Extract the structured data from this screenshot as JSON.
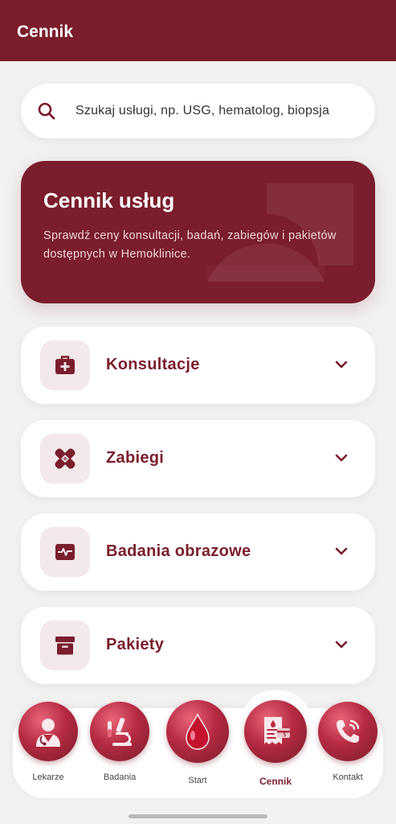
{
  "appbar": {
    "title": "Cennik"
  },
  "search": {
    "placeholder": "Szukaj usługi, np. USG, hematolog, biopsja",
    "icon": "search-icon"
  },
  "hero": {
    "title": "Cennik usług",
    "description": "Sprawdź ceny konsultacji, badań, zabiegów i pakietów dostępnych w Hemoklinice."
  },
  "categories": [
    {
      "label": "Konsultacje",
      "icon": "medical-kit-icon"
    },
    {
      "label": "Zabiegi",
      "icon": "bandage-icon"
    },
    {
      "label": "Badania obrazowe",
      "icon": "monitor-pulse-icon"
    },
    {
      "label": "Pakiety",
      "icon": "archive-box-icon"
    }
  ],
  "bottom_nav": {
    "items": [
      {
        "label": "Lekarze",
        "icon": "doctor-icon"
      },
      {
        "label": "Badania",
        "icon": "microscope-icon"
      },
      {
        "label": "Start",
        "icon": "blood-drop-icon"
      },
      {
        "label": "Cennik",
        "icon": "price-receipt-icon",
        "active": true
      },
      {
        "label": "Kontakt",
        "icon": "phone-icon"
      }
    ]
  },
  "colors": {
    "primary": "#7a1d2c",
    "background": "#f2f1f1",
    "icon_tile": "#f3e8ea"
  }
}
